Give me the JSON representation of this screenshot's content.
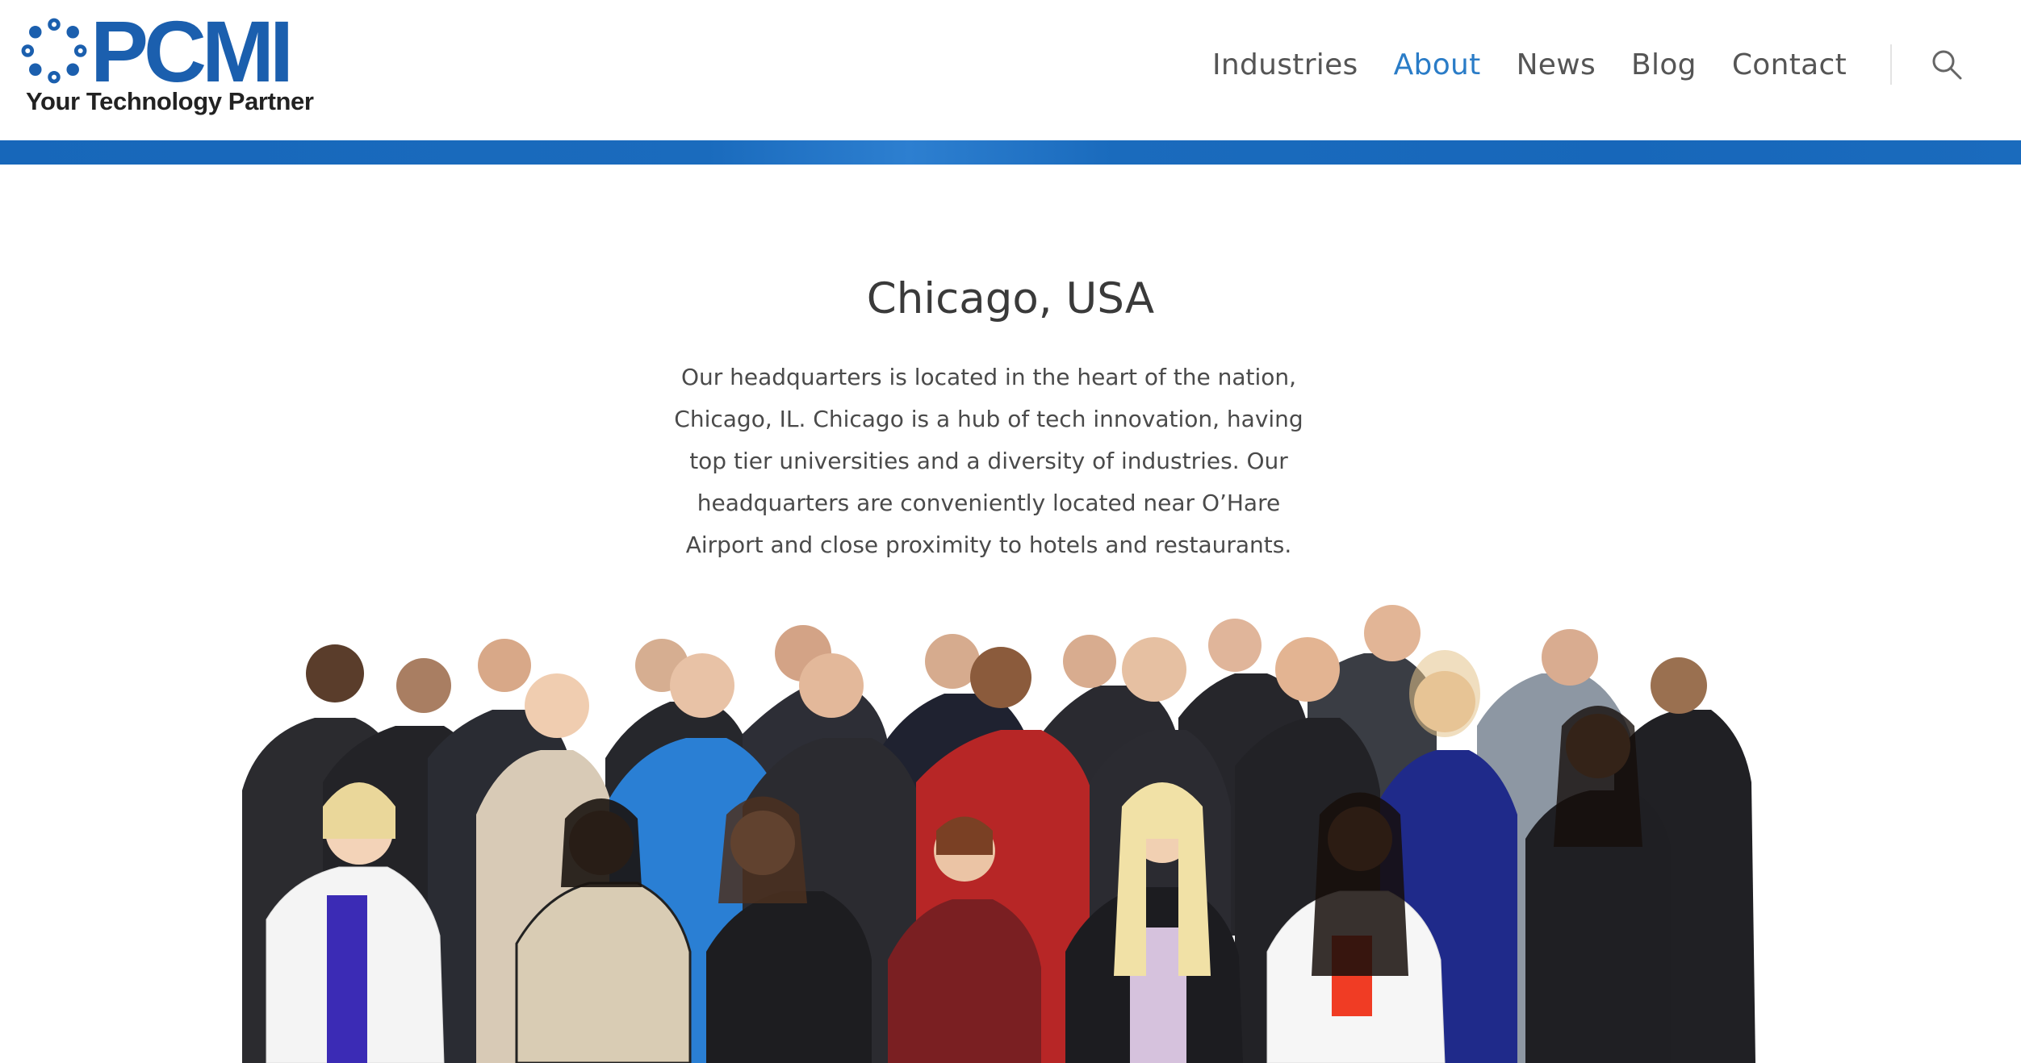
{
  "header": {
    "logo": {
      "wordmark": "PCMI",
      "tagline": "Your Technology Partner",
      "brand_color": "#1b5fae"
    },
    "nav": {
      "items": [
        {
          "label": "Industries",
          "active": false
        },
        {
          "label": "About",
          "active": true
        },
        {
          "label": "News",
          "active": false
        },
        {
          "label": "Blog",
          "active": false
        },
        {
          "label": "Contact",
          "active": false
        }
      ],
      "search_icon": "search-icon",
      "active_color": "#2a7cc7"
    },
    "band_color": "#1767ba"
  },
  "main": {
    "heading": "Chicago, USA",
    "description": "Our headquarters is located in the heart of the nation, Chicago, IL. Chicago is a hub of tech innovation, having top tier universities and a diversity of industries. Our headquarters are conveniently located near O’Hare Airport and close proximity to hotels and restaurants.",
    "team_photo": "team-photo"
  }
}
